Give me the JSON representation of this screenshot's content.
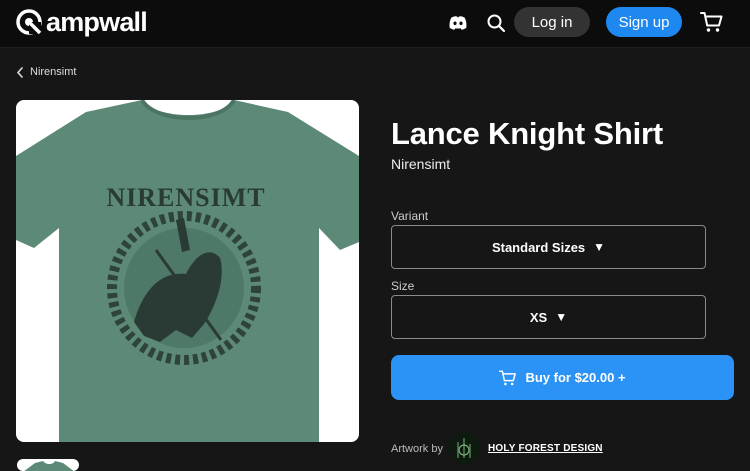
{
  "brand": {
    "name": "ampwall"
  },
  "header": {
    "discord_icon": "discord-icon",
    "search_icon": "search-icon",
    "login_label": "Log in",
    "signup_label": "Sign up",
    "cart_icon": "cart-icon"
  },
  "breadcrumb": {
    "label": "Nirensimt"
  },
  "product": {
    "title": "Lance Knight Shirt",
    "artist": "Nirensimt",
    "image_print_text": "NIRENSIMT",
    "shirt_color": "#5d8a76",
    "variant": {
      "label": "Variant",
      "value": "Standard Sizes"
    },
    "size": {
      "label": "Size",
      "value": "XS"
    },
    "buy_label": "Buy for $20.00 +",
    "artwork": {
      "label": "Artwork by",
      "artist": "HOLY FOREST DESIGN"
    }
  },
  "colors": {
    "accent": "#2b93f5",
    "signup": "#1e88f0",
    "background": "#161616"
  }
}
